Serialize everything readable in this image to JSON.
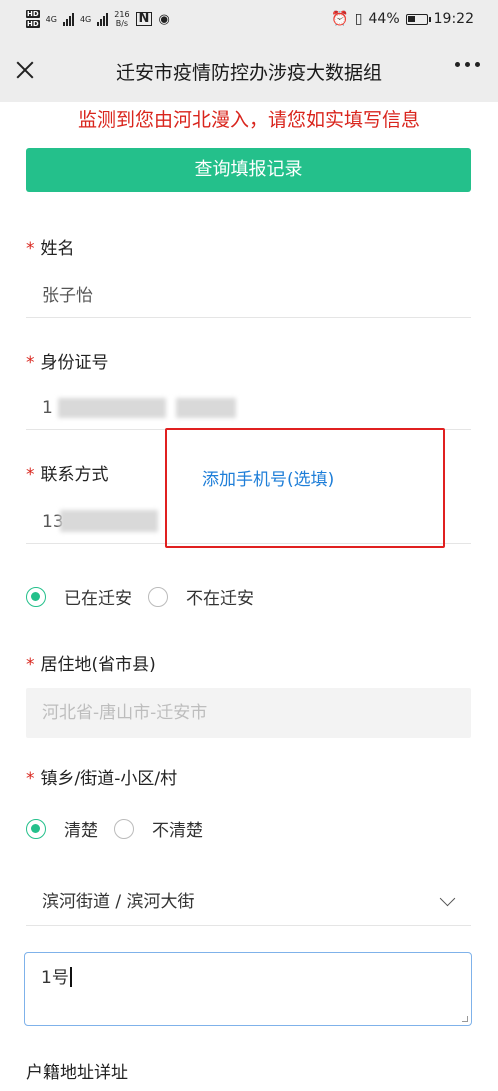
{
  "status_bar": {
    "hd1": "HD",
    "hd2": "HD",
    "net1": "4G",
    "net2": "4G",
    "speed": "216",
    "speed_unit": "B/s",
    "nfc": "N",
    "battery": "44%",
    "time": "19:22",
    "battery_level": 0.44
  },
  "header": {
    "title": "迁安市疫情防控办涉疫大数据组"
  },
  "alert_text": "监测到您由河北漫入，请您如实填写信息",
  "query_button": "查询填报记录",
  "form": {
    "name": {
      "required": "*",
      "label": "姓名",
      "value": "张子怡"
    },
    "id_card": {
      "required": "*",
      "label": "身份证号",
      "value": "1"
    },
    "contact": {
      "required": "*",
      "label": "联系方式",
      "value": "13",
      "add_phone": "添加手机号(选填)"
    },
    "location_radio": {
      "option1": "已在迁安",
      "option2": "不在迁安",
      "selected": "option1"
    },
    "residence": {
      "required": "*",
      "label": "居住地(省市县)",
      "value": "河北省-唐山市-迁安市"
    },
    "town": {
      "required": "*",
      "label": "镇乡/街道-小区/村"
    },
    "clarity_radio": {
      "option1": "清楚",
      "option2": "不清楚",
      "selected": "option1"
    },
    "street_select": {
      "value": "滨河街道 / 滨河大街"
    },
    "address_detail": {
      "value": "1号"
    },
    "hukou": {
      "label": "户籍地址详址"
    }
  },
  "colors": {
    "accent": "#24c08b",
    "alert": "#d9251d",
    "link": "#1e7ed8"
  }
}
